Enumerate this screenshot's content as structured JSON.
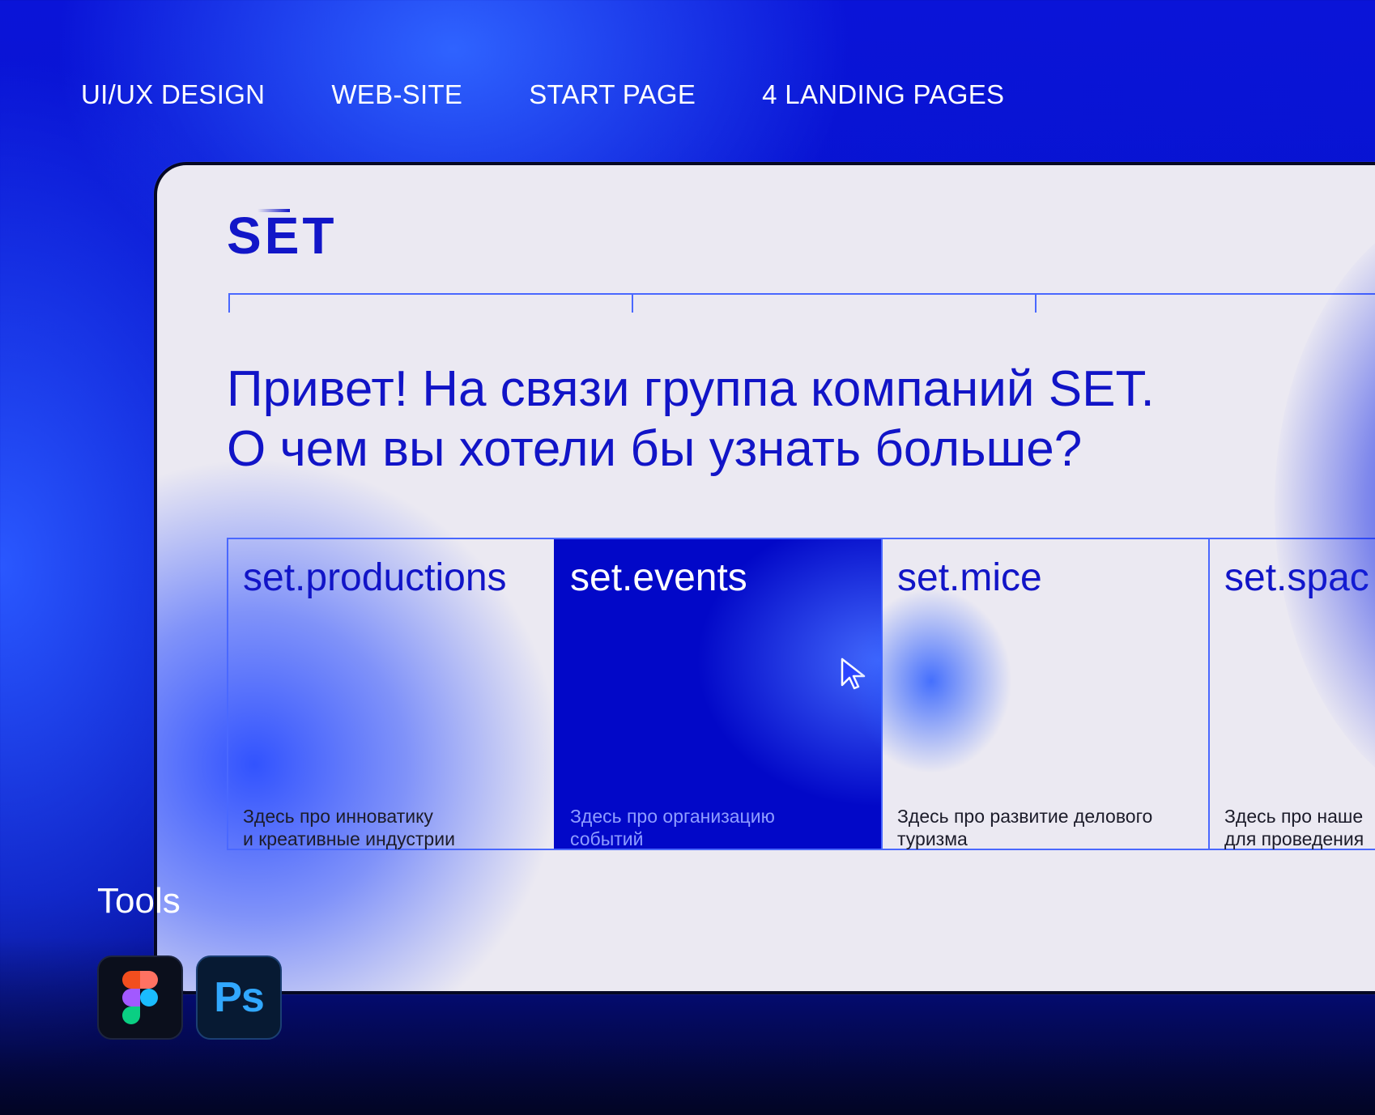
{
  "tags": [
    "UI/UX DESIGN",
    "WEB-SITE",
    "START PAGE",
    "4 LANDING PAGES"
  ],
  "site": {
    "logo": "SET",
    "headline": [
      "Привет! На связи группа компаний SET.",
      "О чем вы хотели бы узнать больше?"
    ],
    "cards": [
      {
        "title": "set.productions",
        "desc": "Здесь про инноватику\nи креативные индустрии"
      },
      {
        "title": "set.events",
        "desc": "Здесь про организацию\nсобытий"
      },
      {
        "title": "set.mice",
        "desc": "Здесь про развитие делового\nтуризма"
      },
      {
        "title": "set.spac",
        "desc": "Здесь про наше\nдля проведения"
      }
    ]
  },
  "tools": {
    "label": "Tools",
    "items": [
      {
        "name": "figma-icon"
      },
      {
        "name": "photoshop-icon",
        "text": "Ps"
      }
    ]
  },
  "colors": {
    "brand_blue": "#1114c7",
    "active_card": "#0208c8",
    "page_bg": "#ebe9f2"
  }
}
